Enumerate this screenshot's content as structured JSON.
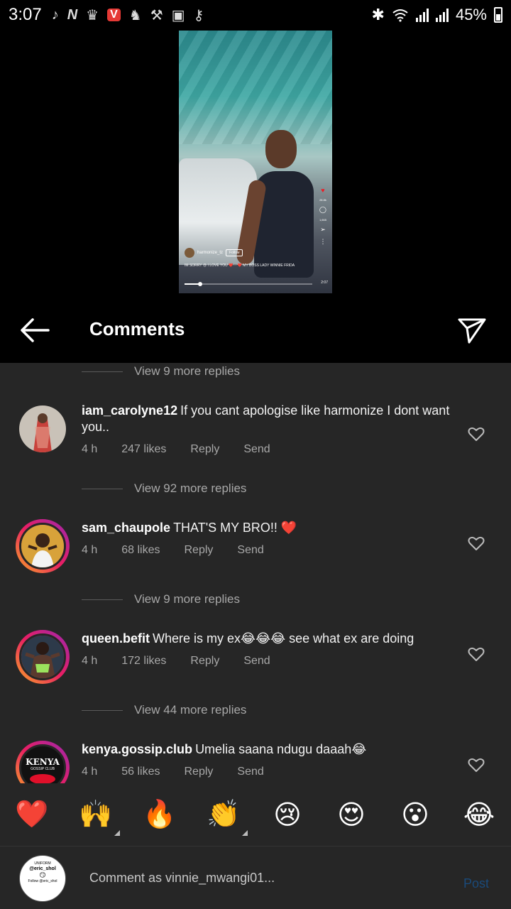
{
  "status_bar": {
    "time": "3:07",
    "battery": "45%",
    "icons": [
      "tiktok-icon",
      "netflix-icon",
      "premier-league-icon",
      "vivaldi-icon",
      "alert-icon",
      "tools-icon",
      "gallery-icon",
      "key-icon"
    ]
  },
  "video": {
    "username": "harmonize_tz",
    "follow_label": "Follow",
    "caption": "IM SORRY 😢 I LOVE YOU ❤️➖❤️ MY BOSS LADY WINNIE FRIDA",
    "likes": "28.8k",
    "comments": "1,665",
    "duration": "2:07",
    "progress": 0.12
  },
  "header": {
    "title": "Comments"
  },
  "comments": [
    {
      "view_replies": "View 9 more replies"
    },
    {
      "username": "iam_carolyne12",
      "text": "If you cant apologise like harmonize I dont want you..",
      "time": "4 h",
      "likes": "247 likes",
      "reply": "Reply",
      "send": "Send",
      "story_ring": false
    },
    {
      "view_replies": "View 92 more replies"
    },
    {
      "username": "sam_chaupole",
      "text": "THAT'S MY BRO!! ❤️",
      "time": "4 h",
      "likes": "68 likes",
      "reply": "Reply",
      "send": "Send",
      "story_ring": true
    },
    {
      "view_replies": "View 9 more replies"
    },
    {
      "username": "queen.befit",
      "text": "Where is my ex😂😂😂 see what ex are doing",
      "time": "4 h",
      "likes": "172 likes",
      "reply": "Reply",
      "send": "Send",
      "story_ring": true
    },
    {
      "view_replies": "View 44 more replies"
    },
    {
      "username": "kenya.gossip.club",
      "text": "Umelia saana ndugu daaah😂",
      "time": "4 h",
      "likes": "56 likes",
      "reply": "Reply",
      "send": "Send",
      "story_ring": true,
      "avatar_text": "KENYA",
      "avatar_subtext": "GOSSIP CLUB"
    }
  ],
  "emoji_bar": [
    "❤️",
    "🙌",
    "🔥",
    "👏",
    "😢",
    "😍",
    "😮",
    "😂"
  ],
  "composer": {
    "avatar_label_top": "UNIFORM",
    "avatar_handle": "@eric_shol",
    "avatar_follow": "Follow @eric_shol",
    "placeholder": "Comment as vinnie_mwangi01...",
    "post_label": "Post"
  },
  "colors": {
    "background": "#262626",
    "header": "#000000",
    "muted_text": "#a8a8a8",
    "post_disabled": "#1a4a7a",
    "heart_red": "#ed1c24"
  }
}
